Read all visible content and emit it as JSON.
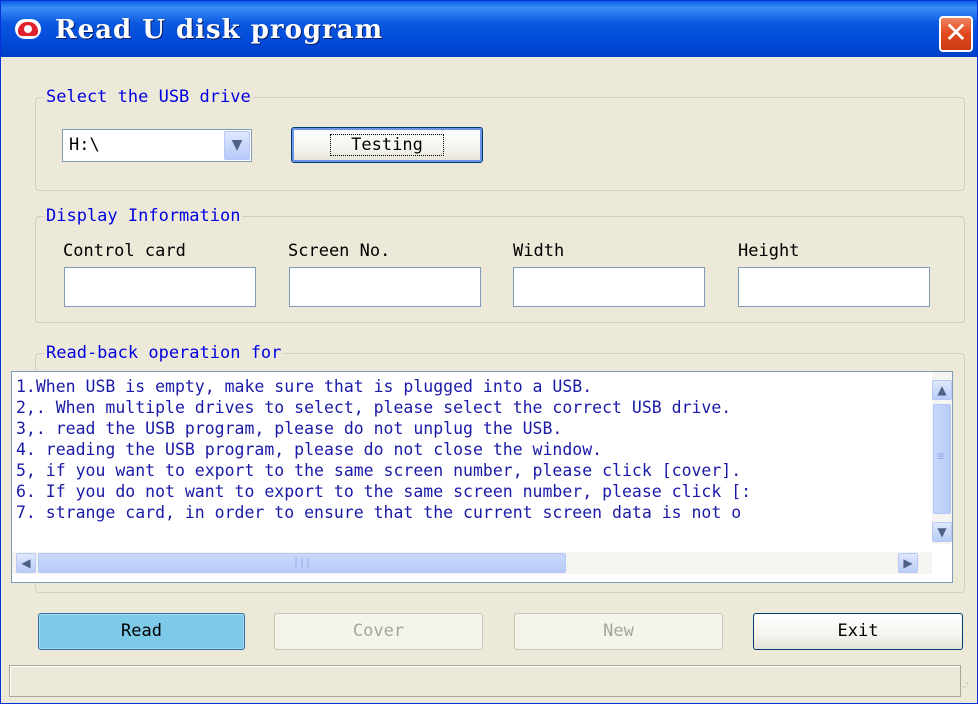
{
  "window": {
    "title": "Read U disk program",
    "close_symbol": "✕"
  },
  "usb_group": {
    "legend": "Select the USB drive",
    "drive_value": "H:\\",
    "testing_label": "Testing"
  },
  "display_group": {
    "legend": "Display Information",
    "labels": [
      "Control card",
      "Screen No.",
      "Width",
      "Height"
    ],
    "values": [
      "",
      "",
      "",
      ""
    ]
  },
  "readback_group": {
    "legend": "Read-back operation for",
    "lines": [
      "1.When USB is empty, make sure that is plugged into a USB.",
      "2,. When multiple drives to select, please select the correct USB drive.",
      "3,. read the USB program, please do not unplug the USB.",
      "4. reading the USB program, please do not close the window.",
      "5, if you want to export to the same screen number, please click [cover].",
      "6. If you do not want to export to the same screen number, please click [:",
      "7. strange card, in order to ensure that the current screen data is not o"
    ]
  },
  "buttons": {
    "read": "Read",
    "cover": "Cover",
    "new": "New",
    "exit": "Exit"
  },
  "icons": {
    "app": "app-logo-icon",
    "close": "close-icon",
    "dropdown": "chevron-down-icon",
    "scroll_up": "scroll-up-icon",
    "scroll_down": "scroll-down-icon",
    "scroll_left": "scroll-left-icon",
    "scroll_right": "scroll-right-icon",
    "grip": "resize-grip-icon"
  },
  "colors": {
    "title_bar": "#0049d8",
    "legend_text": "#0000e0",
    "log_text": "#1a1aa8",
    "read_button": "#7ccae8"
  },
  "status": {
    "text": ""
  }
}
